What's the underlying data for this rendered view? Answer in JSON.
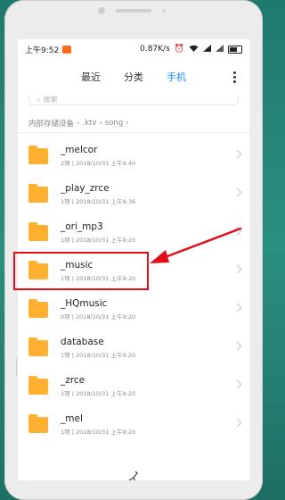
{
  "status": {
    "time": "上午9:52",
    "speed": "0.87K/s",
    "battery": "61",
    "notification_color": "#ff6a1a"
  },
  "tabs": [
    {
      "label": "最近"
    },
    {
      "label": "分类"
    },
    {
      "label": "手机"
    }
  ],
  "active_tab": "手机",
  "search": {
    "placeholder": "搜索"
  },
  "breadcrumb": [
    ".ktv",
    "song"
  ],
  "breadcrumb_root": "内部存储设备",
  "folders": [
    {
      "name": "_melcor",
      "meta": "2项 | 2018/10/31 上午9:40"
    },
    {
      "name": "_play_zrce",
      "meta": "1项 | 2018/10/31 上午9:36"
    },
    {
      "name": "_ori_mp3",
      "meta": "1项 | 2018/10/31 上午9:20"
    },
    {
      "name": "_music",
      "meta": "1项 | 2018/10/31 上午9:20"
    },
    {
      "name": "_HQmusic",
      "meta": "0项 | 2018/10/31 上午9:20"
    },
    {
      "name": "database",
      "meta": "1项 | 2018/10/31 上午9:20"
    },
    {
      "name": "_zrce",
      "meta": "1项 | 2018/10/31 上午9:20"
    },
    {
      "name": "_mel",
      "meta": "1项 | 2018/10/31 上午9:20"
    }
  ],
  "bottom": {
    "label": "清理",
    "icon": "broom-icon"
  },
  "colors": {
    "accent": "#1a8cff",
    "folder": "#ffb030",
    "highlight": "#e30d18"
  }
}
